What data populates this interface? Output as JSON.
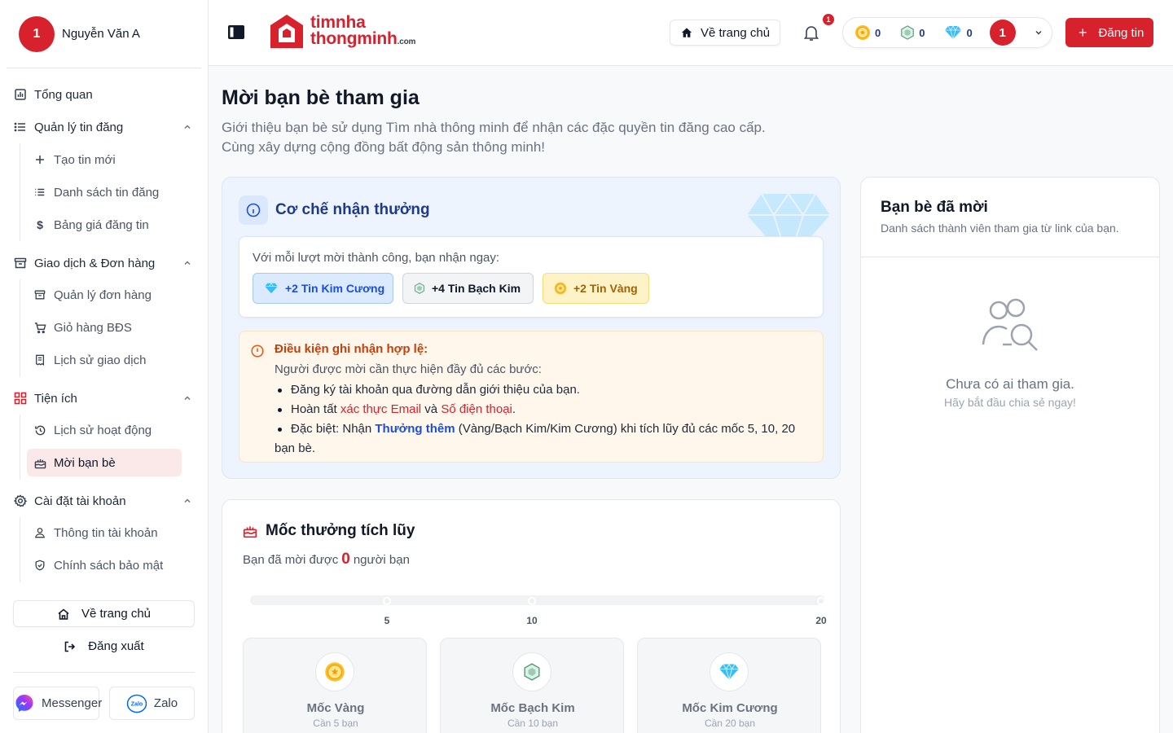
{
  "user": {
    "initial": "1",
    "name": "Nguyễn Văn A"
  },
  "sidebar": {
    "overview": "Tổng quan",
    "listings": {
      "label": "Quản lý tin đăng",
      "items": [
        "Tạo tin mới",
        "Danh sách tin đăng",
        "Bảng giá đăng tin"
      ]
    },
    "orders": {
      "label": "Giao dịch & Đơn hàng",
      "items": [
        "Quản lý đơn hàng",
        "Giỏ hàng BĐS",
        "Lịch sử giao dịch"
      ]
    },
    "utilities": {
      "label": "Tiện ích",
      "items": [
        "Lịch sử hoạt động",
        "Mời bạn bè"
      ]
    },
    "account": {
      "label": "Cài đặt tài khoản",
      "items": [
        "Thông tin tài khoản",
        "Chính sách bảo mật"
      ]
    },
    "home": "Về trang chủ",
    "logout": "Đăng xuất",
    "messenger": "Messenger",
    "zalo": "Zalo"
  },
  "header": {
    "logo_line1": "timnha",
    "logo_line2": "thongminh",
    "logo_suffix": ".com",
    "home": "Về trang chủ",
    "notif_count": "1",
    "gold": "0",
    "platinum": "0",
    "diamond": "0",
    "avatar_initial": "1",
    "post": "Đăng tin"
  },
  "page": {
    "title": "Mời bạn bè tham gia",
    "desc1": "Giới thiệu bạn bè sử dụng Tìm nhà thông minh để nhận các đặc quyền tin đăng cao cấp.",
    "desc2": "Cùng xây dựng cộng đồng bất động sản thông minh!"
  },
  "reward": {
    "title": "Cơ chế nhận thưởng",
    "intro": "Với mỗi lượt mời thành công, bạn nhận ngay:",
    "chips": [
      "+2 Tin Kim Cương",
      "+4 Tin Bạch Kim",
      "+2 Tin Vàng"
    ],
    "cond_title": "Điều kiện ghi nhận hợp lệ:",
    "cond_sub": "Người được mời cần thực hiện đầy đủ các bước:",
    "b1": "Đăng ký tài khoản qua đường dẫn giới thiệu của bạn.",
    "b2_pre": "Hoàn tất ",
    "b2_email": "xác thực Email",
    "b2_mid": " và ",
    "b2_phone": "Số điện thoại",
    "b2_end": ".",
    "b3_pre": "Đặc biệt: Nhận ",
    "b3_bonus": "Thưởng thêm",
    "b3_end": " (Vàng/Bạch Kim/Kim Cương) khi tích lũy đủ các mốc 5, 10, 20 bạn bè."
  },
  "milestone": {
    "title": "Mốc thưởng tích lũy",
    "invited_pre": "Bạn đã mời được",
    "invited_count": "0",
    "invited_post": "người bạn",
    "progress": 0,
    "ticks": [
      "5",
      "10",
      "20"
    ],
    "cards": [
      {
        "title": "Mốc Vàng",
        "sub": "Cần 5 bạn"
      },
      {
        "title": "Mốc Bạch Kim",
        "sub": "Cần 10 bạn"
      },
      {
        "title": "Mốc Kim Cương",
        "sub": "Cần 20 bạn"
      }
    ]
  },
  "friends": {
    "title": "Bạn bè đã mời",
    "desc": "Danh sách thành viên tham gia từ link của bạn.",
    "empty_title": "Chưa có ai tham gia.",
    "empty_sub": "Hãy bắt đầu chia sẻ ngay!"
  },
  "colors": {
    "brand": "#d7222d",
    "diamond": "#1d4ed8",
    "gold": "#a16207"
  }
}
